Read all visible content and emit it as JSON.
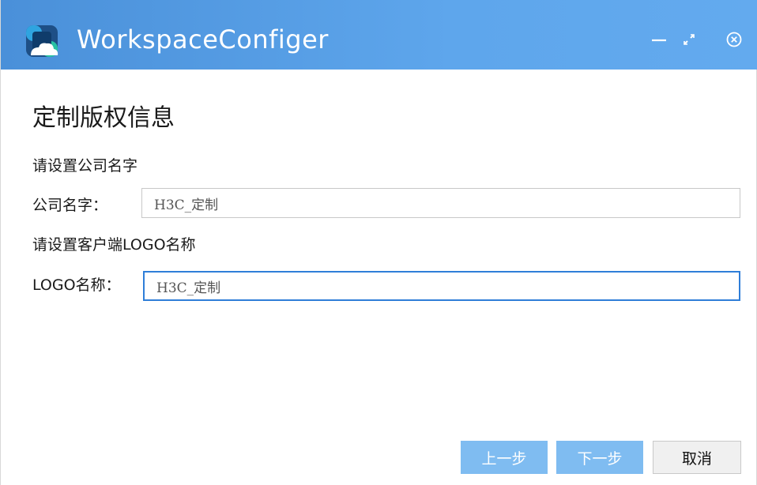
{
  "window": {
    "title": "WorkspaceConfiger",
    "accent_color": "#5ea6ec",
    "icons": {
      "logo": "app-logo-icon",
      "minimize": "minimize-icon",
      "maximize": "maximize-icon",
      "close": "close-circle-icon"
    }
  },
  "page": {
    "title": "定制版权信息",
    "company_section_label": "请设置公司名字",
    "company_field_label": "公司名字：",
    "company_value": "H3C_定制",
    "logo_section_label": "请设置客户端LOGO名称",
    "logo_field_label": "LOGO名称：",
    "logo_value": "H3C_定制"
  },
  "footer": {
    "prev_label": "上一步",
    "next_label": "下一步",
    "cancel_label": "取消",
    "primary_color": "#7fbcf1"
  }
}
